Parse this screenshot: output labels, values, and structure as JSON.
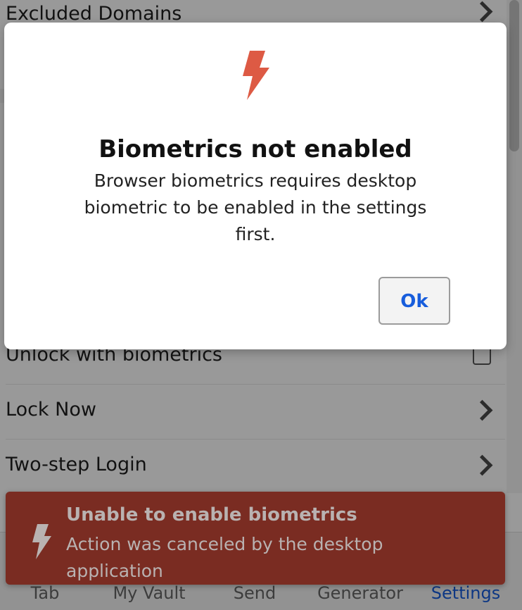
{
  "settings": {
    "rows": [
      {
        "label": "Excluded Domains"
      },
      {
        "label": "Unlock with biometrics"
      },
      {
        "label": "Lock Now"
      },
      {
        "label": "Two-step Login"
      }
    ]
  },
  "tabbar": {
    "tabs": [
      {
        "label": "Tab"
      },
      {
        "label": "My Vault"
      },
      {
        "label": "Send"
      },
      {
        "label": "Generator"
      },
      {
        "label": "Settings"
      }
    ],
    "active_color": "#175ddc"
  },
  "dialog": {
    "icon": "lightning-bolt-icon",
    "icon_color": "#dd5a44",
    "title": "Biometrics not enabled",
    "body": "Browser biometrics requires desktop biometric to be enabled in the settings first.",
    "ok_label": "Ok"
  },
  "toast": {
    "icon": "lightning-bolt-icon",
    "background": "#7a2c22",
    "title": "Unable to enable biometrics",
    "message": "Action was canceled by the desktop application"
  }
}
